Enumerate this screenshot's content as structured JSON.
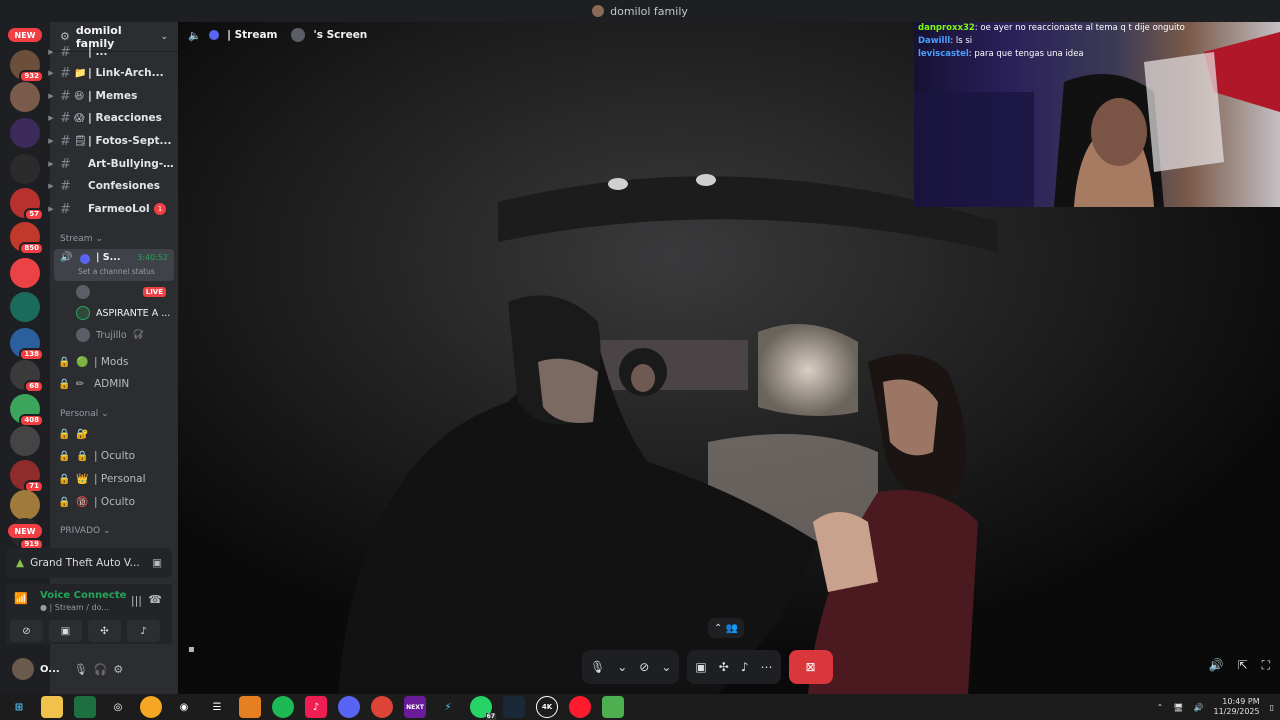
{
  "titlebar": {
    "title": "domilol family"
  },
  "rail": {
    "new_top": "NEW",
    "new_bottom": "NEW",
    "items": [
      {
        "badge": "932",
        "color": "#6b4f3a"
      },
      {
        "badge": "",
        "color": "#7a5a4a"
      },
      {
        "badge": "",
        "color": "#3b2a5a"
      },
      {
        "badge": "",
        "color": "#2b2b2b"
      },
      {
        "badge": "57",
        "color": "#b8312f"
      },
      {
        "badge": "850",
        "color": "#c0392b"
      },
      {
        "badge": "",
        "color": "#ed4245"
      },
      {
        "badge": "",
        "color": "#1b6b5a"
      },
      {
        "badge": "138",
        "color": "#2c5f9e"
      },
      {
        "badge": "68",
        "color": "#3a3a3a"
      },
      {
        "badge": "408",
        "color": "#3ba55c"
      },
      {
        "badge": "",
        "color": "#444"
      },
      {
        "badge": "71",
        "color": "#8e2b2b"
      },
      {
        "badge": "",
        "color": "#a07a3a"
      },
      {
        "badge": "919",
        "color": "#2a2a2a"
      }
    ]
  },
  "server": {
    "name": "domilol family"
  },
  "channels": [
    {
      "emoji": "",
      "name": "| ...",
      "arrow": true
    },
    {
      "emoji": "📁",
      "name": "| Link-Arch...",
      "arrow": true
    },
    {
      "emoji": "😆",
      "name": "| Memes",
      "arrow": true
    },
    {
      "emoji": "😱",
      "name": "| Reacciones",
      "arrow": true
    },
    {
      "emoji": "🗒",
      "name": "| Fotos-Sept...",
      "arrow": true
    },
    {
      "emoji": "",
      "name": "Art-Bullying-A...",
      "arrow": true
    },
    {
      "emoji": "",
      "name": "Confesiones",
      "arrow": true
    },
    {
      "emoji": "",
      "name": "FarmeoLol",
      "arrow": true,
      "mention": "1"
    }
  ],
  "stream_category": "Stream",
  "stream_channel": {
    "name": "| S...",
    "timer": "3:40:52",
    "status": "Set a channel status"
  },
  "live_label": "LIVE",
  "members": [
    {
      "name": "ASPIRANTE A ..."
    },
    {
      "name": "Trujillo"
    }
  ],
  "locked_channels": [
    {
      "emoji": "🟢",
      "name": "| Mods"
    },
    {
      "emoji": "✏",
      "name": "ADMIN"
    }
  ],
  "personal_category": "Personal",
  "personal_channels": [
    {
      "emoji": "🔐",
      "name": ""
    },
    {
      "emoji": "🔒",
      "name": "| Oculto"
    },
    {
      "emoji": "👑",
      "name": "| Personal"
    },
    {
      "emoji": "🔞",
      "name": "| Oculto"
    }
  ],
  "privado_category": "PRIVADO",
  "game_activity": "Grand Theft Auto V...",
  "voice": {
    "status": "Voice Connecte",
    "channel": "| Stream / do..."
  },
  "user": {
    "name": "O..."
  },
  "stage": {
    "header_channel": "| Stream",
    "header_screen": "'s Screen"
  },
  "chat": [
    {
      "user": "danproxx32",
      "msg": ": oe ayer no reaccionaste al tema q t dije onguito"
    },
    {
      "user": "Dawilll",
      "msg": ": ls si"
    },
    {
      "user": "leviscastel",
      "msg": ": para que tengas una idea"
    }
  ],
  "taskbar": {
    "badges": {
      "whatsapp": "67"
    },
    "apps": [
      "Files",
      "Excel",
      "Browser",
      "Discord",
      "Spotify",
      "TikTok",
      "Chrome",
      "Kick",
      "Steam",
      "4K",
      "Opera",
      "Minecraft"
    ],
    "time": "10:49 PM",
    "date": "11/29/2025"
  },
  "colors": {
    "accent": "#5865f2",
    "danger": "#da373c",
    "voice_green": "#23a55a"
  }
}
